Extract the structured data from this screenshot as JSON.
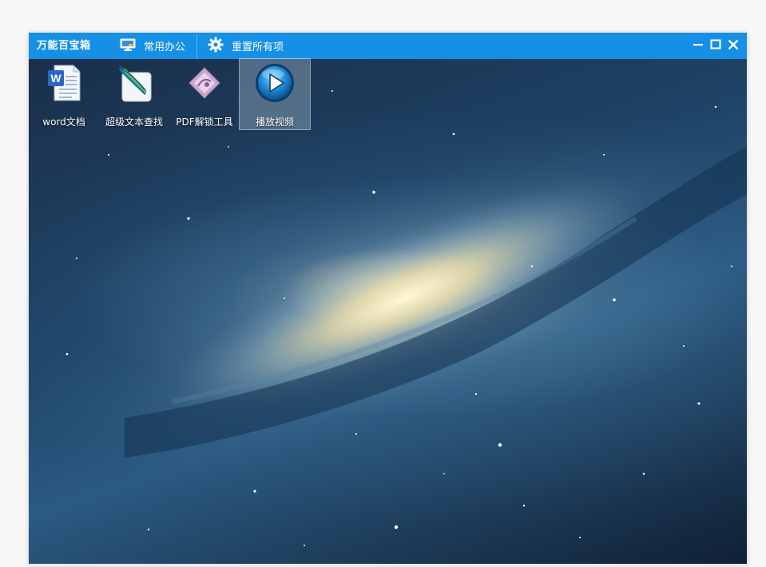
{
  "window": {
    "title": "万能百宝箱",
    "toolbar": {
      "office_label": "常用办公",
      "reset_label": "重置所有项"
    },
    "controls": {
      "minimize_icon": "minimize-icon",
      "maximize_icon": "maximize-icon",
      "close_icon": "close-icon"
    }
  },
  "desktop": {
    "wallpaper": "galaxy",
    "icons": [
      {
        "label": "word文档",
        "icon": "word-document-icon",
        "selected": false
      },
      {
        "label": "超级文本查找",
        "icon": "feather-search-icon",
        "selected": false
      },
      {
        "label": "PDF解锁工具",
        "icon": "pdf-unlock-icon",
        "selected": false
      },
      {
        "label": "播放视频",
        "icon": "play-video-icon",
        "selected": true
      }
    ]
  },
  "colors": {
    "titlebar": "#1590e6",
    "title_text": "#ffffff"
  }
}
